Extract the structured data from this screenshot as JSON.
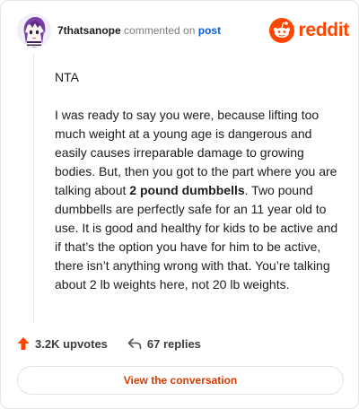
{
  "header": {
    "username": "7thatsanope",
    "verb": " commented on ",
    "target": "post",
    "brand": "reddit"
  },
  "comment": {
    "line1": "NTA",
    "p2_before": "I was ready to say you were, because lifting too much weight at a young age is dangerous and easily causes irreparable damage to growing bodies. But, then you got to the part where you are talking about ",
    "p2_bold": "2 pound dumbbells",
    "p2_after": ". Two pound dumbbells are perfectly safe for an 11 year old to use. It is good and healthy for kids to be active and if that’s the option you have for him to be active, there isn’t anything wrong with that. You’re talking about 2 lb weights here, not 20 lb weights."
  },
  "actions": {
    "upvotes": "3.2K upvotes",
    "replies": "67 replies"
  },
  "cta": {
    "label": "View the conversation"
  },
  "icons": {
    "avatar": "anime-avatar",
    "brand_logo": "reddit-snoo-icon",
    "upvote": "upvote-arrow-icon",
    "reply": "reply-arrow-icon"
  },
  "colors": {
    "brand": "#ff4500",
    "link": "#0a5bd4",
    "cta_text": "#d93a00"
  }
}
